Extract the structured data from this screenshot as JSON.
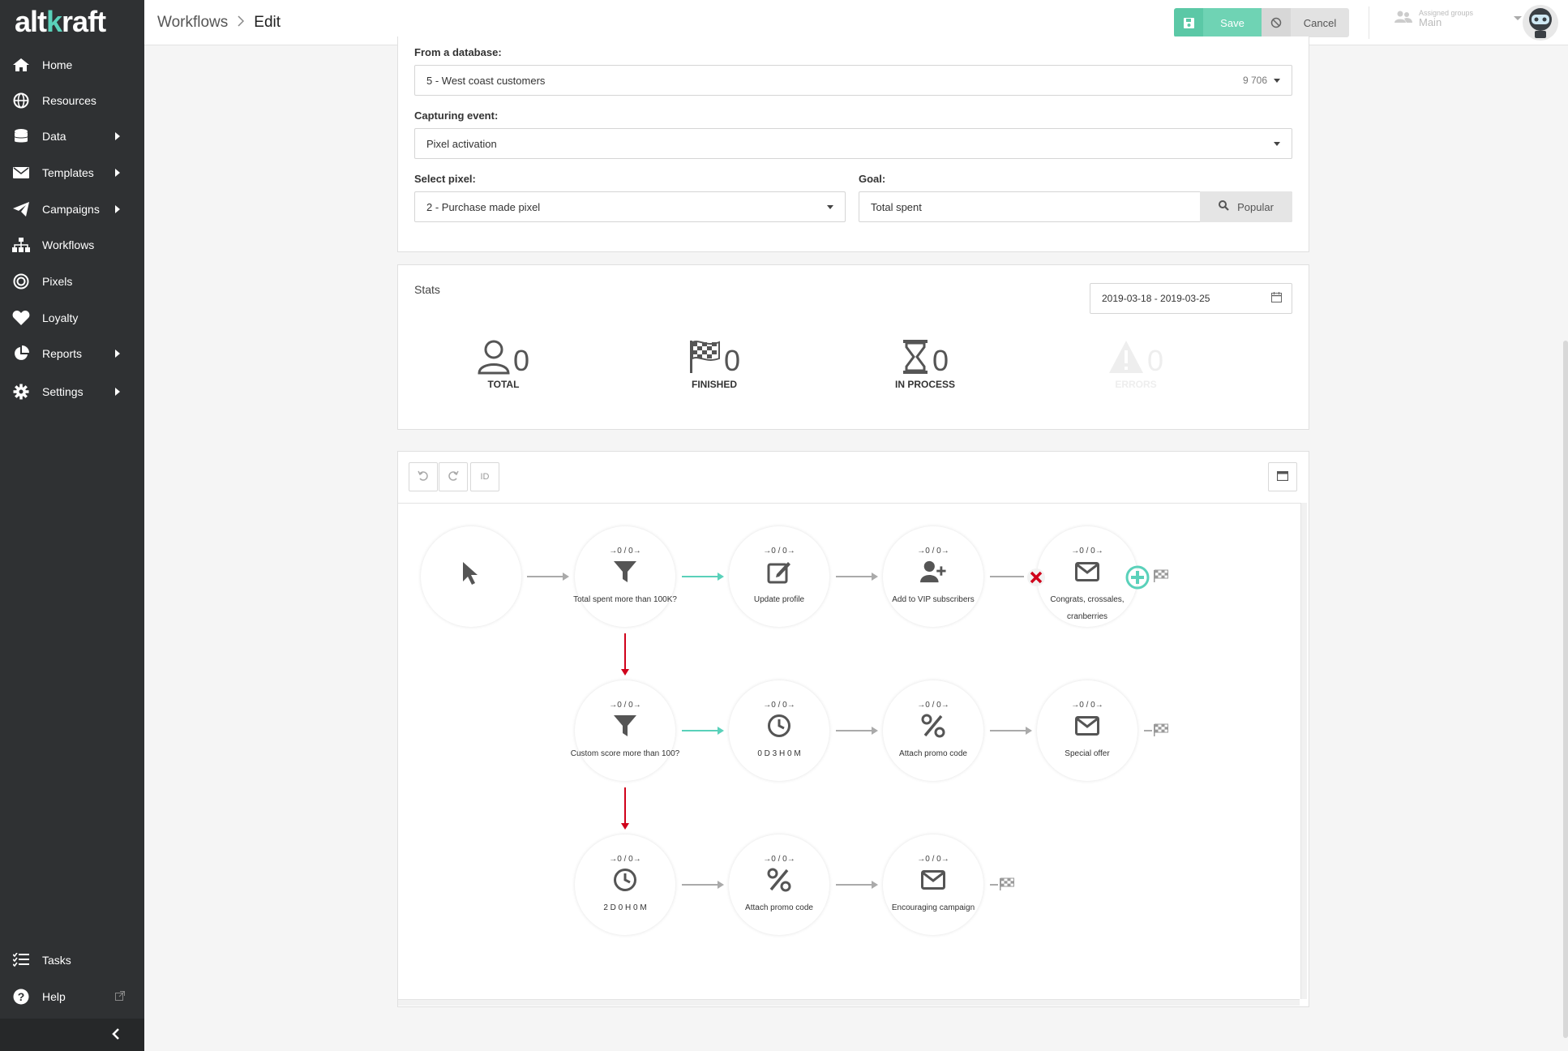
{
  "app": {
    "logo_prefix": "alt",
    "logo_accent": "k",
    "logo_suffix": "raft"
  },
  "sidebar": {
    "items": [
      {
        "label": "Home",
        "icon": "home-icon"
      },
      {
        "label": "Resources",
        "icon": "globe-icon"
      },
      {
        "label": "Data",
        "icon": "database-icon",
        "submenu": true
      },
      {
        "label": "Templates",
        "icon": "envelope-icon",
        "submenu": true
      },
      {
        "label": "Campaigns",
        "icon": "paper-plane-icon",
        "submenu": true
      },
      {
        "label": "Workflows",
        "icon": "sitemap-icon"
      },
      {
        "label": "Pixels",
        "icon": "target-icon"
      },
      {
        "label": "Loyalty",
        "icon": "heart-icon"
      },
      {
        "label": "Reports",
        "icon": "pie-chart-icon",
        "submenu": true
      },
      {
        "label": "Settings",
        "icon": "gear-icon",
        "submenu": true
      }
    ],
    "bottom": [
      {
        "label": "Tasks",
        "icon": "tasks-icon"
      },
      {
        "label": "Help",
        "icon": "question-icon"
      }
    ]
  },
  "header": {
    "breadcrumb_parent": "Workflows",
    "breadcrumb_current": "Edit",
    "save_label": "Save",
    "cancel_label": "Cancel",
    "groups_label": "Assigned groups",
    "groups_value": "Main"
  },
  "form": {
    "database_label": "From a database:",
    "database_value": "5 - West coast customers",
    "database_count": "9 706",
    "event_label": "Capturing event:",
    "event_value": "Pixel activation",
    "pixel_label": "Select pixel:",
    "pixel_value": "2 - Purchase made pixel",
    "goal_label": "Goal:",
    "goal_value": "Total spent",
    "popular_label": "Popular"
  },
  "stats": {
    "title": "Stats",
    "date_range": "2019-03-18 - 2019-03-25",
    "total_value": "0",
    "total_label": "TOTAL",
    "finished_value": "0",
    "finished_label": "FINISHED",
    "in_process_value": "0",
    "in_process_label": "IN PROCESS",
    "errors_value": "0",
    "errors_label": "ERRORS"
  },
  "toolbar": {
    "id_label": "ID"
  },
  "workflow": {
    "nodes": [
      {
        "id": "n1",
        "counter": "0 / 0",
        "title": "Total spent more than 100K?",
        "icon": "filter-icon"
      },
      {
        "id": "n2",
        "counter": "0 / 0",
        "title": "Update profile",
        "icon": "edit-icon"
      },
      {
        "id": "n3",
        "counter": "0 / 0",
        "title": "Add to VIP subscribers",
        "icon": "user-plus-icon"
      },
      {
        "id": "n4",
        "counter": "0 / 0",
        "title": "Congrats, crossales, cranberries",
        "icon": "envelope-icon"
      },
      {
        "id": "n5",
        "counter": "0 / 0",
        "title": "Custom score more than 100?",
        "icon": "filter-icon"
      },
      {
        "id": "n6",
        "counter": "0 / 0",
        "title": "0 D 3 H 0 M",
        "icon": "clock-icon"
      },
      {
        "id": "n7",
        "counter": "0 / 0",
        "title": "Attach promo code",
        "icon": "percent-icon"
      },
      {
        "id": "n8",
        "counter": "0 / 0",
        "title": "Special offer",
        "icon": "envelope-icon"
      },
      {
        "id": "n9",
        "counter": "0 / 0",
        "title": "2 D 0 H 0 M",
        "icon": "clock-icon"
      },
      {
        "id": "n10",
        "counter": "0 / 0",
        "title": "Attach promo code",
        "icon": "percent-icon"
      },
      {
        "id": "n11",
        "counter": "0 / 0",
        "title": "Encouraging campaign",
        "icon": "envelope-icon"
      }
    ]
  },
  "colors": {
    "sidebar_bg": "#2f3133",
    "accent": "#5ad1ba",
    "save_button": "#6fd3b4",
    "yes_arrow": "#5ad1ba",
    "no_arrow": "#d0021b",
    "remove": "#d0021b"
  }
}
